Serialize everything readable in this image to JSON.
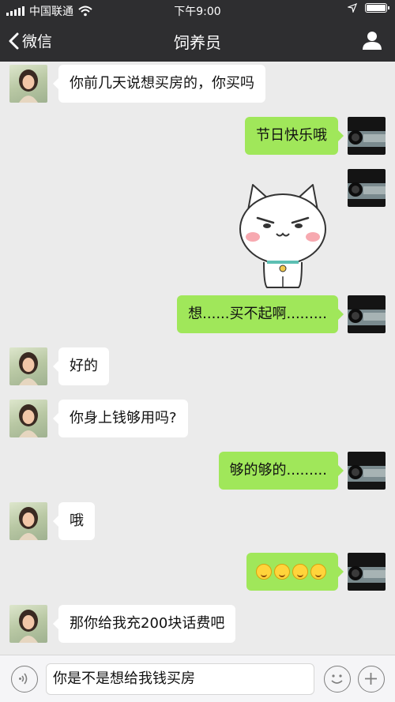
{
  "status_bar": {
    "carrier": "中国联通",
    "time": "下午9:00"
  },
  "nav": {
    "back_label": "微信",
    "title": "饲养员"
  },
  "messages": [
    {
      "sender": "contact",
      "text": "你前几天说想买房的，你买吗"
    },
    {
      "sender": "me",
      "text": "节日快乐哦"
    },
    {
      "sender": "me",
      "type": "sticker",
      "sticker": "white-cat-sticker"
    },
    {
      "sender": "me",
      "text": "想......买不起啊........."
    },
    {
      "sender": "contact",
      "text": "好的"
    },
    {
      "sender": "contact",
      "text": "你身上钱够用吗?"
    },
    {
      "sender": "me",
      "text": "够的够的........."
    },
    {
      "sender": "contact",
      "text": "哦"
    },
    {
      "sender": "me",
      "type": "emoji",
      "emoji": "grin-face",
      "count": 4
    },
    {
      "sender": "contact",
      "text": "那你给我充200块话费吧"
    }
  ],
  "input": {
    "value": "你是不是想给我钱买房"
  },
  "colors": {
    "bar_bg": "#2e2e30",
    "chat_bg": "#ebebeb",
    "my_bubble": "#a0e75a",
    "their_bubble": "#ffffff"
  }
}
